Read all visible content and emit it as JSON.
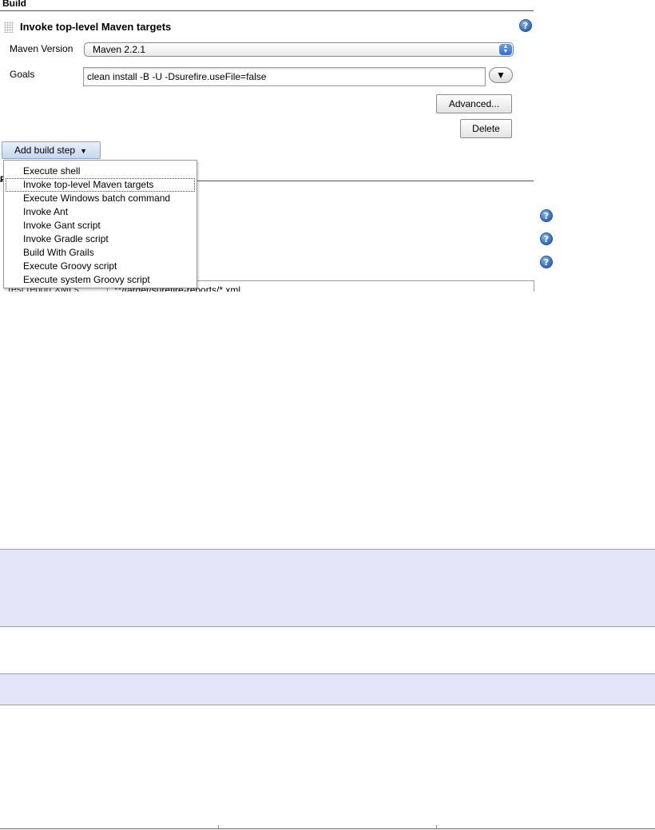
{
  "build_section": {
    "title": "Build"
  },
  "builder": {
    "title": "Invoke top-level Maven targets",
    "maven_version_label": "Maven Version",
    "maven_version_value": "Maven 2.2.1",
    "goals_label": "Goals",
    "goals_value": "clean install -B -U -Dsurefire.useFile=false",
    "expand_glyph": "▼",
    "advanced_label": "Advanced...",
    "delete_label": "Delete",
    "help_glyph": "?"
  },
  "add_build_step": {
    "label": "Add build step",
    "caret": "▼",
    "menu": [
      {
        "label": "Execute shell"
      },
      {
        "label": "Invoke top-level Maven targets"
      },
      {
        "label": "Execute Windows batch command"
      },
      {
        "label": "Invoke Ant"
      },
      {
        "label": "Invoke Gant script"
      },
      {
        "label": "Invoke Gradle script"
      },
      {
        "label": "Build With Grails"
      },
      {
        "label": "Execute Groovy script"
      },
      {
        "label": "Execute system Groovy script"
      }
    ],
    "highlighted_index": 1
  },
  "post_build": {
    "partial_label": "Test report XMLs",
    "partial_value": "**/target/surefire-reports/*.xml"
  },
  "colors": {
    "band_background": "#e4e5f8",
    "help_icon": "#3f78c6",
    "button_accent": "#c6d6ee"
  },
  "icons": {
    "help": "help-icon",
    "select_arrows": "updown-arrows-icon",
    "expand": "chevron-down-icon",
    "drag": "drag-handle-icon"
  }
}
